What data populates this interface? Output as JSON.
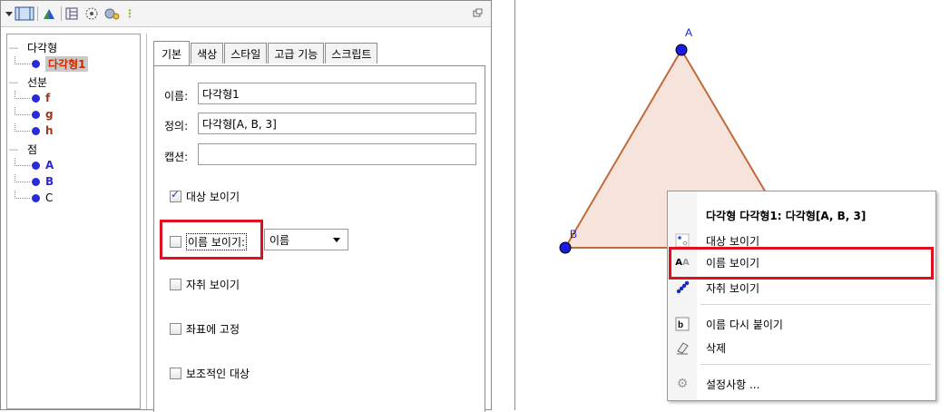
{
  "properties": {
    "tree": {
      "categories": [
        {
          "label": "다각형",
          "items": [
            {
              "label": "다각형1",
              "color": "#cc2a00",
              "selected": true
            }
          ]
        },
        {
          "label": "선분",
          "items": [
            {
              "label": "f",
              "color": "#c0392b"
            },
            {
              "label": "g",
              "color": "#c0392b"
            },
            {
              "label": "h",
              "color": "#c0392b"
            }
          ]
        },
        {
          "label": "점",
          "items": [
            {
              "label": "A",
              "color": "#2a2ad8"
            },
            {
              "label": "B",
              "color": "#2a2ad8"
            },
            {
              "label": "C",
              "color": "#000000"
            }
          ]
        }
      ]
    },
    "tabs": [
      "기본",
      "색상",
      "스타일",
      "고급 기능",
      "스크립트"
    ],
    "active_tab": "기본",
    "fields": {
      "name_label": "이름:",
      "name_value": "다각형1",
      "definition_label": "정의:",
      "definition_value": "다각형[A, B, 3]",
      "caption_label": "캡션:",
      "caption_value": ""
    },
    "checkboxes": {
      "show_object": {
        "label": "대상 보이기",
        "checked": true
      },
      "show_label": {
        "label": "이름 보이기:",
        "checked": false
      },
      "show_trace": {
        "label": "자취 보이기",
        "checked": false
      },
      "fix_object": {
        "label": "좌표에 고정",
        "checked": false
      },
      "auxiliary": {
        "label": "보조적인 대상",
        "checked": false
      }
    },
    "label_dropdown": "이름"
  },
  "graphics": {
    "points": [
      {
        "name": "A",
        "color": "#1a1ae0"
      },
      {
        "name": "B",
        "color": "#1a1ae0"
      }
    ],
    "polygon_fill": "#f6e4dc",
    "polygon_stroke": "#c06a3a"
  },
  "context_menu": {
    "title": "다각형 다각형1: 다각형[A, B, 3]",
    "items": [
      {
        "label": "대상 보이기",
        "icon": "show-object-icon"
      },
      {
        "label": "이름 보이기",
        "icon": "show-label-icon"
      },
      {
        "label": "자취 보이기",
        "icon": "trace-icon"
      },
      {
        "label": "이름 다시 붙이기",
        "icon": "rename-icon"
      },
      {
        "label": "삭제",
        "icon": "eraser-icon"
      },
      {
        "label": "설정사항 ...",
        "icon": "settings-gear-icon"
      }
    ]
  },
  "colors": {
    "highlight_red": "#e01020"
  }
}
